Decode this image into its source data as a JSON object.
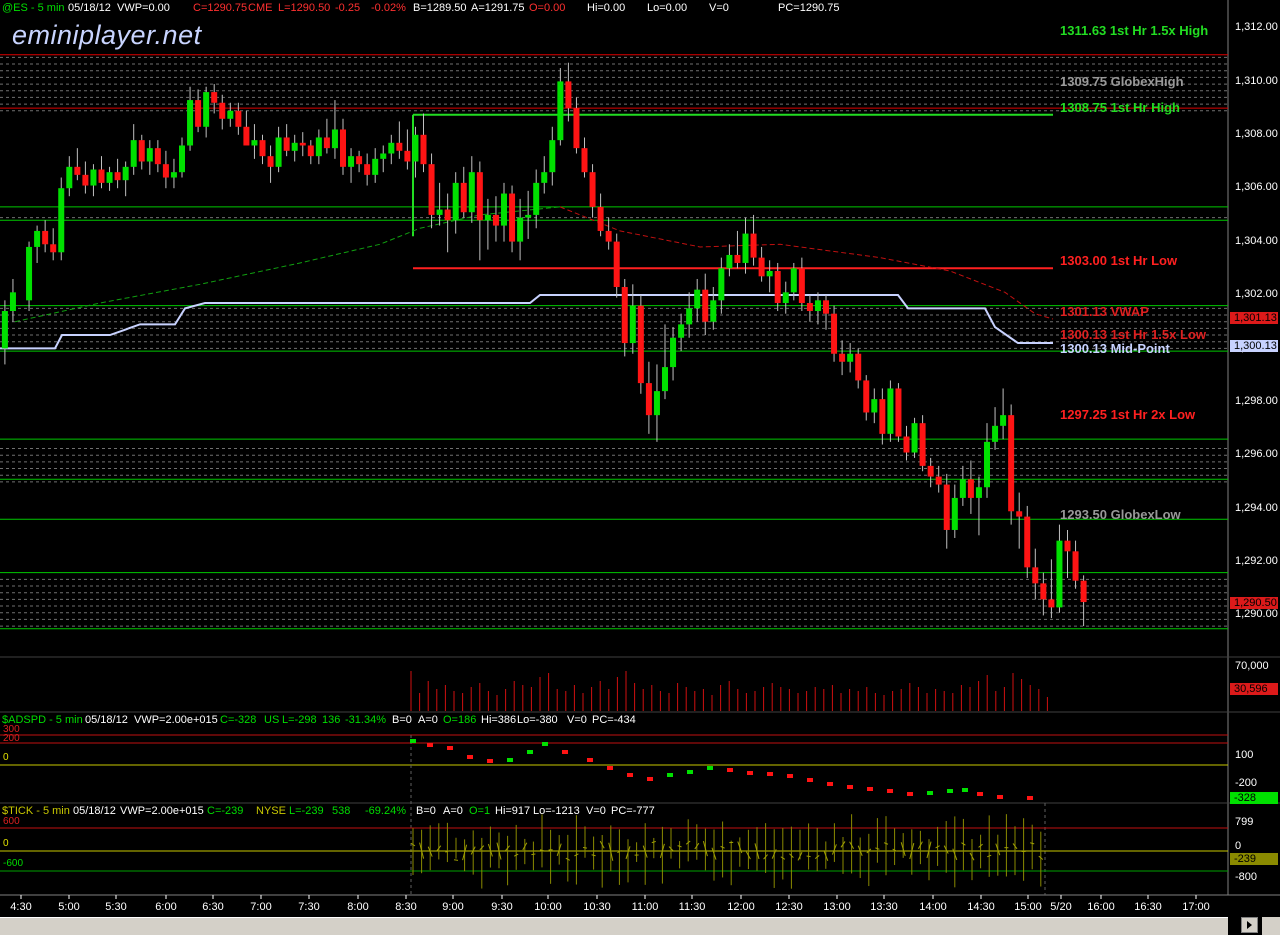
{
  "watermark": "eminiplayer.net",
  "colors": {
    "up": "#00e000",
    "down": "#ff1414",
    "green_line": "#00c800",
    "red_line": "#dc0000",
    "white_line": "#c8d2ff",
    "yellow_line": "#c8c800",
    "grid": "#707070"
  },
  "headers": {
    "es": {
      "symbol": "@ES - 5 min",
      "date": "05/18/12",
      "vwp": "VWP=0.00",
      "close": "C=1290.75",
      "exchange": "CME",
      "last": "L=1290.50",
      "chg": "-0.25",
      "pct": "-0.02%",
      "bid": "B=1289.50",
      "ask": "A=1291.75",
      "open": "O=0.00",
      "hi": "Hi=0.00",
      "lo": "Lo=0.00",
      "vol": "V=0",
      "pc": "PC=1290.75"
    },
    "adspd": {
      "symbol": "$ADSPD - 5 min",
      "date": "05/18/12",
      "vwp": "VWP=2.00e+015",
      "close": "C=-328",
      "exchange": "US",
      "last": "L=-298",
      "chg": "136",
      "pct": "-31.34%",
      "bid": "B=0",
      "ask": "A=0",
      "open": "O=186",
      "hi": "Hi=386",
      "lo": "Lo=-380",
      "vol": "V=0",
      "pc": "PC=-434"
    },
    "tick": {
      "symbol": "$TICK - 5 min",
      "date": "05/18/12",
      "vwp": "VWP=2.00e+015",
      "close": "C=-239",
      "exchange": "NYSE",
      "last": "L=-239",
      "chg": "538",
      "pct": "-69.24%",
      "bid": "B=0",
      "ask": "A=0",
      "open": "O=1",
      "hi": "Hi=917",
      "lo": "Lo=-1213",
      "vol": "V=0",
      "pc": "PC=-777"
    }
  },
  "levels": [
    {
      "label": "1311.63 1st Hr  1.5x High",
      "color": "#22dd22"
    },
    {
      "label": "1309.75 GlobexHigh",
      "color": "#999999"
    },
    {
      "label": "1308.75 1st Hr  High",
      "color": "#22dd22"
    },
    {
      "label": "1303.00 1st Hr  Low",
      "color": "#ff2020"
    },
    {
      "label": "1301.13 VWAP",
      "color": "#dd2020"
    },
    {
      "label": "1300.13 1st Hr  1.5x Low",
      "color": "#dd2020"
    },
    {
      "label": "1300.13 Mid-Point",
      "color": "#c8d2ff"
    },
    {
      "label": "1297.25 1st Hr  2x Low",
      "color": "#ff2020"
    },
    {
      "label": "1293.50 GlobexLow",
      "color": "#999999"
    }
  ],
  "price_axis": {
    "ticks": [
      "1,312.00",
      "1,310.00",
      "1,308.00",
      "1,306.00",
      "1,304.00",
      "1,302.00",
      "1,300.00",
      "1,298.00",
      "1,296.00",
      "1,294.00",
      "1,292.00",
      "1,290.00"
    ],
    "badges": [
      "1,301.13",
      "1,300.13",
      "1,290.50"
    ]
  },
  "volume_axis": {
    "ticks": [
      "70,000"
    ],
    "badge": "30,596"
  },
  "adspd_axis": {
    "ticks": [
      "100",
      "-200"
    ],
    "badge": "-328",
    "left_labels": [
      "300",
      "200",
      "0"
    ]
  },
  "tick_axis": {
    "ticks": [
      "799",
      "0",
      "-800"
    ],
    "badge": "-239",
    "left_labels": [
      "600",
      "0",
      "-600"
    ]
  },
  "time_axis": [
    "4:30",
    "5:00",
    "5:30",
    "6:00",
    "6:30",
    "7:00",
    "7:30",
    "8:00",
    "8:30",
    "9:00",
    "9:30",
    "10:00",
    "10:30",
    "11:00",
    "11:30",
    "12:00",
    "12:30",
    "13:00",
    "13:30",
    "14:00",
    "14:30",
    "15:00",
    "5/20",
    "16:00",
    "16:30",
    "17:00"
  ],
  "chart_data": {
    "type": "candlestick",
    "title": "@ES - 5 min",
    "ylabel": "",
    "ylim": [
      1289.2,
      1312.6
    ],
    "x_range": [
      "4:30",
      "17:00"
    ],
    "candles": [
      {
        "t": "4:20",
        "o": 1300.0,
        "h": 1301.8,
        "l": 1299.4,
        "c": 1301.4
      },
      {
        "t": "4:25",
        "o": 1301.4,
        "h": 1302.6,
        "l": 1301.0,
        "c": 1302.1
      },
      {
        "t": "4:35",
        "o": 1301.8,
        "h": 1304.0,
        "l": 1301.4,
        "c": 1303.8
      },
      {
        "t": "4:40",
        "o": 1303.8,
        "h": 1304.6,
        "l": 1303.2,
        "c": 1304.4
      },
      {
        "t": "4:45",
        "o": 1304.4,
        "h": 1304.8,
        "l": 1303.6,
        "c": 1303.9
      },
      {
        "t": "4:50",
        "o": 1303.9,
        "h": 1304.5,
        "l": 1303.3,
        "c": 1303.6
      },
      {
        "t": "4:55",
        "o": 1303.6,
        "h": 1306.4,
        "l": 1303.3,
        "c": 1306.0
      },
      {
        "t": "5:00",
        "o": 1306.0,
        "h": 1307.2,
        "l": 1305.7,
        "c": 1306.8
      },
      {
        "t": "5:05",
        "o": 1306.8,
        "h": 1307.5,
        "l": 1306.3,
        "c": 1306.5
      },
      {
        "t": "5:10",
        "o": 1306.5,
        "h": 1307.0,
        "l": 1305.8,
        "c": 1306.1
      },
      {
        "t": "5:15",
        "o": 1306.1,
        "h": 1306.9,
        "l": 1305.7,
        "c": 1306.7
      },
      {
        "t": "5:20",
        "o": 1306.7,
        "h": 1307.2,
        "l": 1306.0,
        "c": 1306.2
      },
      {
        "t": "5:25",
        "o": 1306.2,
        "h": 1306.8,
        "l": 1305.9,
        "c": 1306.6
      },
      {
        "t": "5:30",
        "o": 1306.6,
        "h": 1307.1,
        "l": 1306.0,
        "c": 1306.3
      },
      {
        "t": "5:35",
        "o": 1306.3,
        "h": 1307.0,
        "l": 1305.7,
        "c": 1306.8
      },
      {
        "t": "5:40",
        "o": 1306.8,
        "h": 1308.4,
        "l": 1306.5,
        "c": 1307.8
      },
      {
        "t": "5:45",
        "o": 1307.8,
        "h": 1308.0,
        "l": 1306.7,
        "c": 1307.0
      },
      {
        "t": "5:50",
        "o": 1307.0,
        "h": 1307.8,
        "l": 1306.5,
        "c": 1307.5
      },
      {
        "t": "5:55",
        "o": 1307.5,
        "h": 1307.8,
        "l": 1306.6,
        "c": 1306.9
      },
      {
        "t": "6:00",
        "o": 1306.9,
        "h": 1307.4,
        "l": 1306.0,
        "c": 1306.4
      },
      {
        "t": "6:05",
        "o": 1306.4,
        "h": 1307.1,
        "l": 1306.0,
        "c": 1306.6
      },
      {
        "t": "6:10",
        "o": 1306.6,
        "h": 1307.9,
        "l": 1306.4,
        "c": 1307.6
      },
      {
        "t": "6:15",
        "o": 1307.6,
        "h": 1309.8,
        "l": 1307.4,
        "c": 1309.3
      },
      {
        "t": "6:20",
        "o": 1309.3,
        "h": 1309.7,
        "l": 1308.1,
        "c": 1308.3
      },
      {
        "t": "6:25",
        "o": 1308.3,
        "h": 1309.8,
        "l": 1307.9,
        "c": 1309.6
      },
      {
        "t": "6:30",
        "o": 1309.6,
        "h": 1309.9,
        "l": 1308.8,
        "c": 1309.2
      },
      {
        "t": "6:35",
        "o": 1309.2,
        "h": 1309.5,
        "l": 1308.2,
        "c": 1308.6
      },
      {
        "t": "6:40",
        "o": 1308.6,
        "h": 1309.2,
        "l": 1308.3,
        "c": 1308.9
      },
      {
        "t": "6:45",
        "o": 1308.9,
        "h": 1309.2,
        "l": 1308.0,
        "c": 1308.3
      },
      {
        "t": "6:50",
        "o": 1308.3,
        "h": 1308.9,
        "l": 1307.8,
        "c": 1307.6
      },
      {
        "t": "6:55",
        "o": 1307.6,
        "h": 1308.4,
        "l": 1307.1,
        "c": 1307.8
      },
      {
        "t": "7:00",
        "o": 1307.8,
        "h": 1308.0,
        "l": 1306.9,
        "c": 1307.2
      },
      {
        "t": "7:05",
        "o": 1307.2,
        "h": 1307.6,
        "l": 1306.2,
        "c": 1306.8
      },
      {
        "t": "7:10",
        "o": 1306.8,
        "h": 1308.3,
        "l": 1306.6,
        "c": 1307.9
      },
      {
        "t": "7:15",
        "o": 1307.9,
        "h": 1308.4,
        "l": 1307.2,
        "c": 1307.4
      },
      {
        "t": "7:20",
        "o": 1307.4,
        "h": 1308.0,
        "l": 1307.0,
        "c": 1307.7
      },
      {
        "t": "7:25",
        "o": 1307.7,
        "h": 1308.1,
        "l": 1307.2,
        "c": 1307.6
      },
      {
        "t": "7:30",
        "o": 1307.6,
        "h": 1307.8,
        "l": 1306.9,
        "c": 1307.2
      },
      {
        "t": "7:35",
        "o": 1307.2,
        "h": 1308.2,
        "l": 1306.9,
        "c": 1307.9
      },
      {
        "t": "7:40",
        "o": 1307.9,
        "h": 1308.6,
        "l": 1307.3,
        "c": 1307.5
      },
      {
        "t": "7:45",
        "o": 1307.5,
        "h": 1309.3,
        "l": 1307.1,
        "c": 1308.2
      },
      {
        "t": "7:50",
        "o": 1308.2,
        "h": 1308.6,
        "l": 1306.5,
        "c": 1306.8
      },
      {
        "t": "7:55",
        "o": 1306.8,
        "h": 1307.5,
        "l": 1306.2,
        "c": 1307.2
      },
      {
        "t": "8:00",
        "o": 1307.2,
        "h": 1307.4,
        "l": 1306.6,
        "c": 1306.9
      },
      {
        "t": "8:05",
        "o": 1306.9,
        "h": 1307.3,
        "l": 1306.1,
        "c": 1306.5
      },
      {
        "t": "8:10",
        "o": 1306.5,
        "h": 1307.5,
        "l": 1306.2,
        "c": 1307.1
      },
      {
        "t": "8:15",
        "o": 1307.1,
        "h": 1307.6,
        "l": 1306.6,
        "c": 1307.3
      },
      {
        "t": "8:20",
        "o": 1307.3,
        "h": 1308.0,
        "l": 1306.9,
        "c": 1307.7
      },
      {
        "t": "8:25",
        "o": 1307.7,
        "h": 1308.5,
        "l": 1307.1,
        "c": 1307.4
      },
      {
        "t": "8:30",
        "o": 1307.4,
        "h": 1308.2,
        "l": 1306.7,
        "c": 1307.0
      },
      {
        "t": "8:35",
        "o": 1307.0,
        "h": 1308.3,
        "l": 1306.4,
        "c": 1308.0
      },
      {
        "t": "8:40",
        "o": 1308.0,
        "h": 1308.8,
        "l": 1306.6,
        "c": 1306.9
      },
      {
        "t": "8:45",
        "o": 1306.9,
        "h": 1307.3,
        "l": 1304.5,
        "c": 1305.0
      },
      {
        "t": "8:50",
        "o": 1305.0,
        "h": 1306.2,
        "l": 1304.6,
        "c": 1305.2
      },
      {
        "t": "8:55",
        "o": 1305.2,
        "h": 1305.8,
        "l": 1303.6,
        "c": 1304.8
      },
      {
        "t": "9:00",
        "o": 1304.8,
        "h": 1306.6,
        "l": 1304.3,
        "c": 1306.2
      },
      {
        "t": "9:05",
        "o": 1306.2,
        "h": 1306.8,
        "l": 1304.9,
        "c": 1305.1
      },
      {
        "t": "9:10",
        "o": 1305.1,
        "h": 1307.2,
        "l": 1304.7,
        "c": 1306.6
      },
      {
        "t": "9:15",
        "o": 1306.6,
        "h": 1307.0,
        "l": 1303.3,
        "c": 1304.8
      },
      {
        "t": "9:20",
        "o": 1304.8,
        "h": 1305.6,
        "l": 1303.7,
        "c": 1305.0
      },
      {
        "t": "9:25",
        "o": 1305.0,
        "h": 1305.7,
        "l": 1304.0,
        "c": 1304.6
      },
      {
        "t": "9:30",
        "o": 1304.6,
        "h": 1306.2,
        "l": 1304.0,
        "c": 1305.8
      },
      {
        "t": "9:35",
        "o": 1305.8,
        "h": 1306.1,
        "l": 1303.6,
        "c": 1304.0
      },
      {
        "t": "9:40",
        "o": 1304.0,
        "h": 1305.6,
        "l": 1303.3,
        "c": 1304.9
      },
      {
        "t": "9:45",
        "o": 1304.9,
        "h": 1305.9,
        "l": 1304.1,
        "c": 1305.0
      },
      {
        "t": "9:50",
        "o": 1305.0,
        "h": 1306.7,
        "l": 1304.5,
        "c": 1306.2
      },
      {
        "t": "9:55",
        "o": 1306.2,
        "h": 1307.2,
        "l": 1305.8,
        "c": 1306.6
      },
      {
        "t": "10:00",
        "o": 1306.6,
        "h": 1308.3,
        "l": 1306.1,
        "c": 1307.8
      },
      {
        "t": "10:05",
        "o": 1307.8,
        "h": 1310.5,
        "l": 1307.6,
        "c": 1310.0
      },
      {
        "t": "10:10",
        "o": 1310.0,
        "h": 1310.7,
        "l": 1308.5,
        "c": 1309.0
      },
      {
        "t": "10:15",
        "o": 1309.0,
        "h": 1309.4,
        "l": 1307.3,
        "c": 1307.5
      },
      {
        "t": "10:20",
        "o": 1307.5,
        "h": 1307.9,
        "l": 1306.4,
        "c": 1306.6
      },
      {
        "t": "10:25",
        "o": 1306.6,
        "h": 1306.9,
        "l": 1304.9,
        "c": 1305.3
      },
      {
        "t": "10:30",
        "o": 1305.3,
        "h": 1305.8,
        "l": 1304.2,
        "c": 1304.4
      },
      {
        "t": "10:35",
        "o": 1304.4,
        "h": 1304.9,
        "l": 1303.7,
        "c": 1304.0
      },
      {
        "t": "10:40",
        "o": 1304.0,
        "h": 1304.3,
        "l": 1301.9,
        "c": 1302.3
      },
      {
        "t": "10:45",
        "o": 1302.3,
        "h": 1302.6,
        "l": 1299.7,
        "c": 1300.2
      },
      {
        "t": "10:50",
        "o": 1300.2,
        "h": 1302.4,
        "l": 1299.8,
        "c": 1301.6
      },
      {
        "t": "10:55",
        "o": 1301.6,
        "h": 1302.0,
        "l": 1298.3,
        "c": 1298.7
      },
      {
        "t": "11:00",
        "o": 1298.7,
        "h": 1299.5,
        "l": 1296.8,
        "c": 1297.5
      },
      {
        "t": "11:05",
        "o": 1297.5,
        "h": 1299.4,
        "l": 1296.5,
        "c": 1298.4
      },
      {
        "t": "11:10",
        "o": 1298.4,
        "h": 1300.9,
        "l": 1298.1,
        "c": 1299.3
      },
      {
        "t": "11:15",
        "o": 1299.3,
        "h": 1300.8,
        "l": 1298.8,
        "c": 1300.4
      },
      {
        "t": "11:20",
        "o": 1300.4,
        "h": 1301.3,
        "l": 1299.9,
        "c": 1300.9
      },
      {
        "t": "11:25",
        "o": 1300.9,
        "h": 1302.1,
        "l": 1300.4,
        "c": 1301.5
      },
      {
        "t": "11:30",
        "o": 1301.5,
        "h": 1302.6,
        "l": 1301.0,
        "c": 1302.2
      },
      {
        "t": "11:35",
        "o": 1302.2,
        "h": 1302.8,
        "l": 1300.5,
        "c": 1301.0
      },
      {
        "t": "11:40",
        "o": 1301.0,
        "h": 1302.3,
        "l": 1300.7,
        "c": 1301.8
      },
      {
        "t": "11:45",
        "o": 1301.8,
        "h": 1303.4,
        "l": 1301.3,
        "c": 1303.0
      },
      {
        "t": "11:50",
        "o": 1303.0,
        "h": 1303.9,
        "l": 1302.7,
        "c": 1303.5
      },
      {
        "t": "11:55",
        "o": 1303.5,
        "h": 1304.4,
        "l": 1303.0,
        "c": 1303.2
      },
      {
        "t": "12:00",
        "o": 1303.2,
        "h": 1304.9,
        "l": 1302.8,
        "c": 1304.3
      },
      {
        "t": "12:05",
        "o": 1304.3,
        "h": 1305.0,
        "l": 1303.1,
        "c": 1303.4
      },
      {
        "t": "12:10",
        "o": 1303.4,
        "h": 1303.8,
        "l": 1302.5,
        "c": 1302.7
      },
      {
        "t": "12:15",
        "o": 1302.7,
        "h": 1303.3,
        "l": 1302.1,
        "c": 1302.9
      },
      {
        "t": "12:20",
        "o": 1302.9,
        "h": 1303.2,
        "l": 1301.4,
        "c": 1301.7
      },
      {
        "t": "12:25",
        "o": 1301.7,
        "h": 1302.5,
        "l": 1301.3,
        "c": 1302.1
      },
      {
        "t": "12:30",
        "o": 1302.1,
        "h": 1303.2,
        "l": 1301.8,
        "c": 1303.0
      },
      {
        "t": "12:35",
        "o": 1303.0,
        "h": 1303.4,
        "l": 1301.4,
        "c": 1301.7
      },
      {
        "t": "12:40",
        "o": 1301.7,
        "h": 1302.0,
        "l": 1301.0,
        "c": 1301.4
      },
      {
        "t": "12:45",
        "o": 1301.4,
        "h": 1302.1,
        "l": 1300.9,
        "c": 1301.8
      },
      {
        "t": "12:50",
        "o": 1301.8,
        "h": 1302.0,
        "l": 1300.7,
        "c": 1301.3
      },
      {
        "t": "12:55",
        "o": 1301.3,
        "h": 1301.6,
        "l": 1299.5,
        "c": 1299.8
      },
      {
        "t": "13:00",
        "o": 1299.8,
        "h": 1300.3,
        "l": 1299.0,
        "c": 1299.5
      },
      {
        "t": "13:05",
        "o": 1299.5,
        "h": 1300.2,
        "l": 1299.1,
        "c": 1299.8
      },
      {
        "t": "13:10",
        "o": 1299.8,
        "h": 1300.0,
        "l": 1298.5,
        "c": 1298.8
      },
      {
        "t": "13:15",
        "o": 1298.8,
        "h": 1299.0,
        "l": 1297.3,
        "c": 1297.6
      },
      {
        "t": "13:20",
        "o": 1297.6,
        "h": 1298.5,
        "l": 1297.2,
        "c": 1298.1
      },
      {
        "t": "13:25",
        "o": 1298.1,
        "h": 1298.5,
        "l": 1296.4,
        "c": 1296.8
      },
      {
        "t": "13:30",
        "o": 1296.8,
        "h": 1298.8,
        "l": 1296.5,
        "c": 1298.5
      },
      {
        "t": "13:35",
        "o": 1298.5,
        "h": 1298.7,
        "l": 1296.5,
        "c": 1296.7
      },
      {
        "t": "13:40",
        "o": 1296.7,
        "h": 1297.1,
        "l": 1295.8,
        "c": 1296.1
      },
      {
        "t": "13:45",
        "o": 1296.1,
        "h": 1297.4,
        "l": 1295.9,
        "c": 1297.2
      },
      {
        "t": "13:50",
        "o": 1297.2,
        "h": 1297.5,
        "l": 1295.4,
        "c": 1295.6
      },
      {
        "t": "13:55",
        "o": 1295.6,
        "h": 1295.9,
        "l": 1294.8,
        "c": 1295.2
      },
      {
        "t": "14:00",
        "o": 1295.2,
        "h": 1295.6,
        "l": 1294.6,
        "c": 1294.9
      },
      {
        "t": "14:05",
        "o": 1294.9,
        "h": 1295.3,
        "l": 1292.5,
        "c": 1293.2
      },
      {
        "t": "14:10",
        "o": 1293.2,
        "h": 1294.9,
        "l": 1292.9,
        "c": 1294.4
      },
      {
        "t": "14:15",
        "o": 1294.4,
        "h": 1295.6,
        "l": 1294.1,
        "c": 1295.1
      },
      {
        "t": "14:20",
        "o": 1295.1,
        "h": 1295.8,
        "l": 1293.8,
        "c": 1294.4
      },
      {
        "t": "14:25",
        "o": 1294.4,
        "h": 1295.2,
        "l": 1293.0,
        "c": 1294.8
      },
      {
        "t": "14:30",
        "o": 1294.8,
        "h": 1297.2,
        "l": 1294.4,
        "c": 1296.5
      },
      {
        "t": "14:35",
        "o": 1296.5,
        "h": 1297.8,
        "l": 1296.2,
        "c": 1297.1
      },
      {
        "t": "14:40",
        "o": 1297.1,
        "h": 1298.5,
        "l": 1296.6,
        "c": 1297.5
      },
      {
        "t": "14:45",
        "o": 1297.5,
        "h": 1297.9,
        "l": 1293.4,
        "c": 1293.9
      },
      {
        "t": "14:50",
        "o": 1293.9,
        "h": 1294.6,
        "l": 1292.5,
        "c": 1293.7
      },
      {
        "t": "14:55",
        "o": 1293.7,
        "h": 1294.1,
        "l": 1291.4,
        "c": 1291.8
      },
      {
        "t": "15:00",
        "o": 1291.8,
        "h": 1292.5,
        "l": 1290.6,
        "c": 1291.2
      },
      {
        "t": "15:05",
        "o": 1291.2,
        "h": 1291.6,
        "l": 1290.0,
        "c": 1290.6
      },
      {
        "t": "15:10",
        "o": 1290.6,
        "h": 1292.1,
        "l": 1289.9,
        "c": 1290.3
      },
      {
        "t": "15:15",
        "o": 1290.3,
        "h": 1293.4,
        "l": 1290.1,
        "c": 1292.8
      },
      {
        "t": "15:20",
        "o": 1292.8,
        "h": 1293.2,
        "l": 1291.4,
        "c": 1292.4
      },
      {
        "t": "15:25",
        "o": 1292.4,
        "h": 1292.8,
        "l": 1291.0,
        "c": 1291.3
      },
      {
        "t": "15:30",
        "o": 1291.3,
        "h": 1291.5,
        "l": 1289.6,
        "c": 1290.5
      }
    ]
  }
}
